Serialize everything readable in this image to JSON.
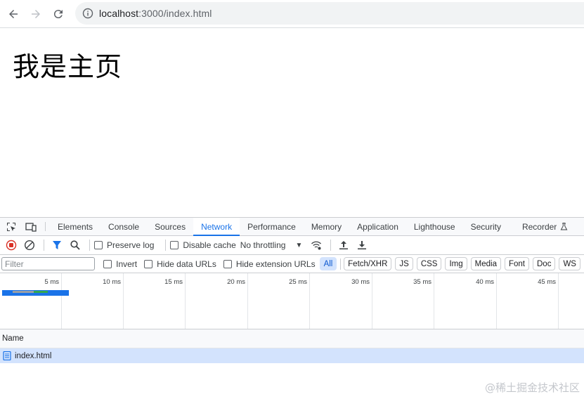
{
  "browser": {
    "back_icon": "arrow-left-icon",
    "forward_icon": "arrow-right-icon",
    "reload_icon": "reload-icon",
    "site_info_icon": "info-circle-icon",
    "url_host": "localhost",
    "url_path": ":3000/index.html"
  },
  "page": {
    "heading": "我是主页"
  },
  "devtools": {
    "tabs": [
      "Elements",
      "Console",
      "Sources",
      "Network",
      "Performance",
      "Memory",
      "Application",
      "Lighthouse",
      "Security",
      "Recorder"
    ],
    "active_tab": "Network",
    "toolbar": {
      "preserve_log": "Preserve log",
      "disable_cache": "Disable cache",
      "throttling": "No throttling"
    },
    "filter": {
      "placeholder": "Filter",
      "invert": "Invert",
      "hide_data_urls": "Hide data URLs",
      "hide_extension_urls": "Hide extension URLs",
      "types": [
        "All",
        "Fetch/XHR",
        "JS",
        "CSS",
        "Img",
        "Media",
        "Font",
        "Doc",
        "WS"
      ],
      "active_type": "All"
    },
    "overview": {
      "ticks": [
        "5 ms",
        "10 ms",
        "15 ms",
        "20 ms",
        "25 ms",
        "30 ms",
        "35 ms",
        "40 ms",
        "45 ms"
      ]
    },
    "table": {
      "name_header": "Name",
      "rows": [
        {
          "name": "index.html",
          "selected": true
        }
      ]
    }
  },
  "watermark": "@稀土掘金技术社区",
  "colors": {
    "accent": "#1a73e8",
    "selected_row": "#d3e3fd",
    "record_red": "#d93025"
  }
}
